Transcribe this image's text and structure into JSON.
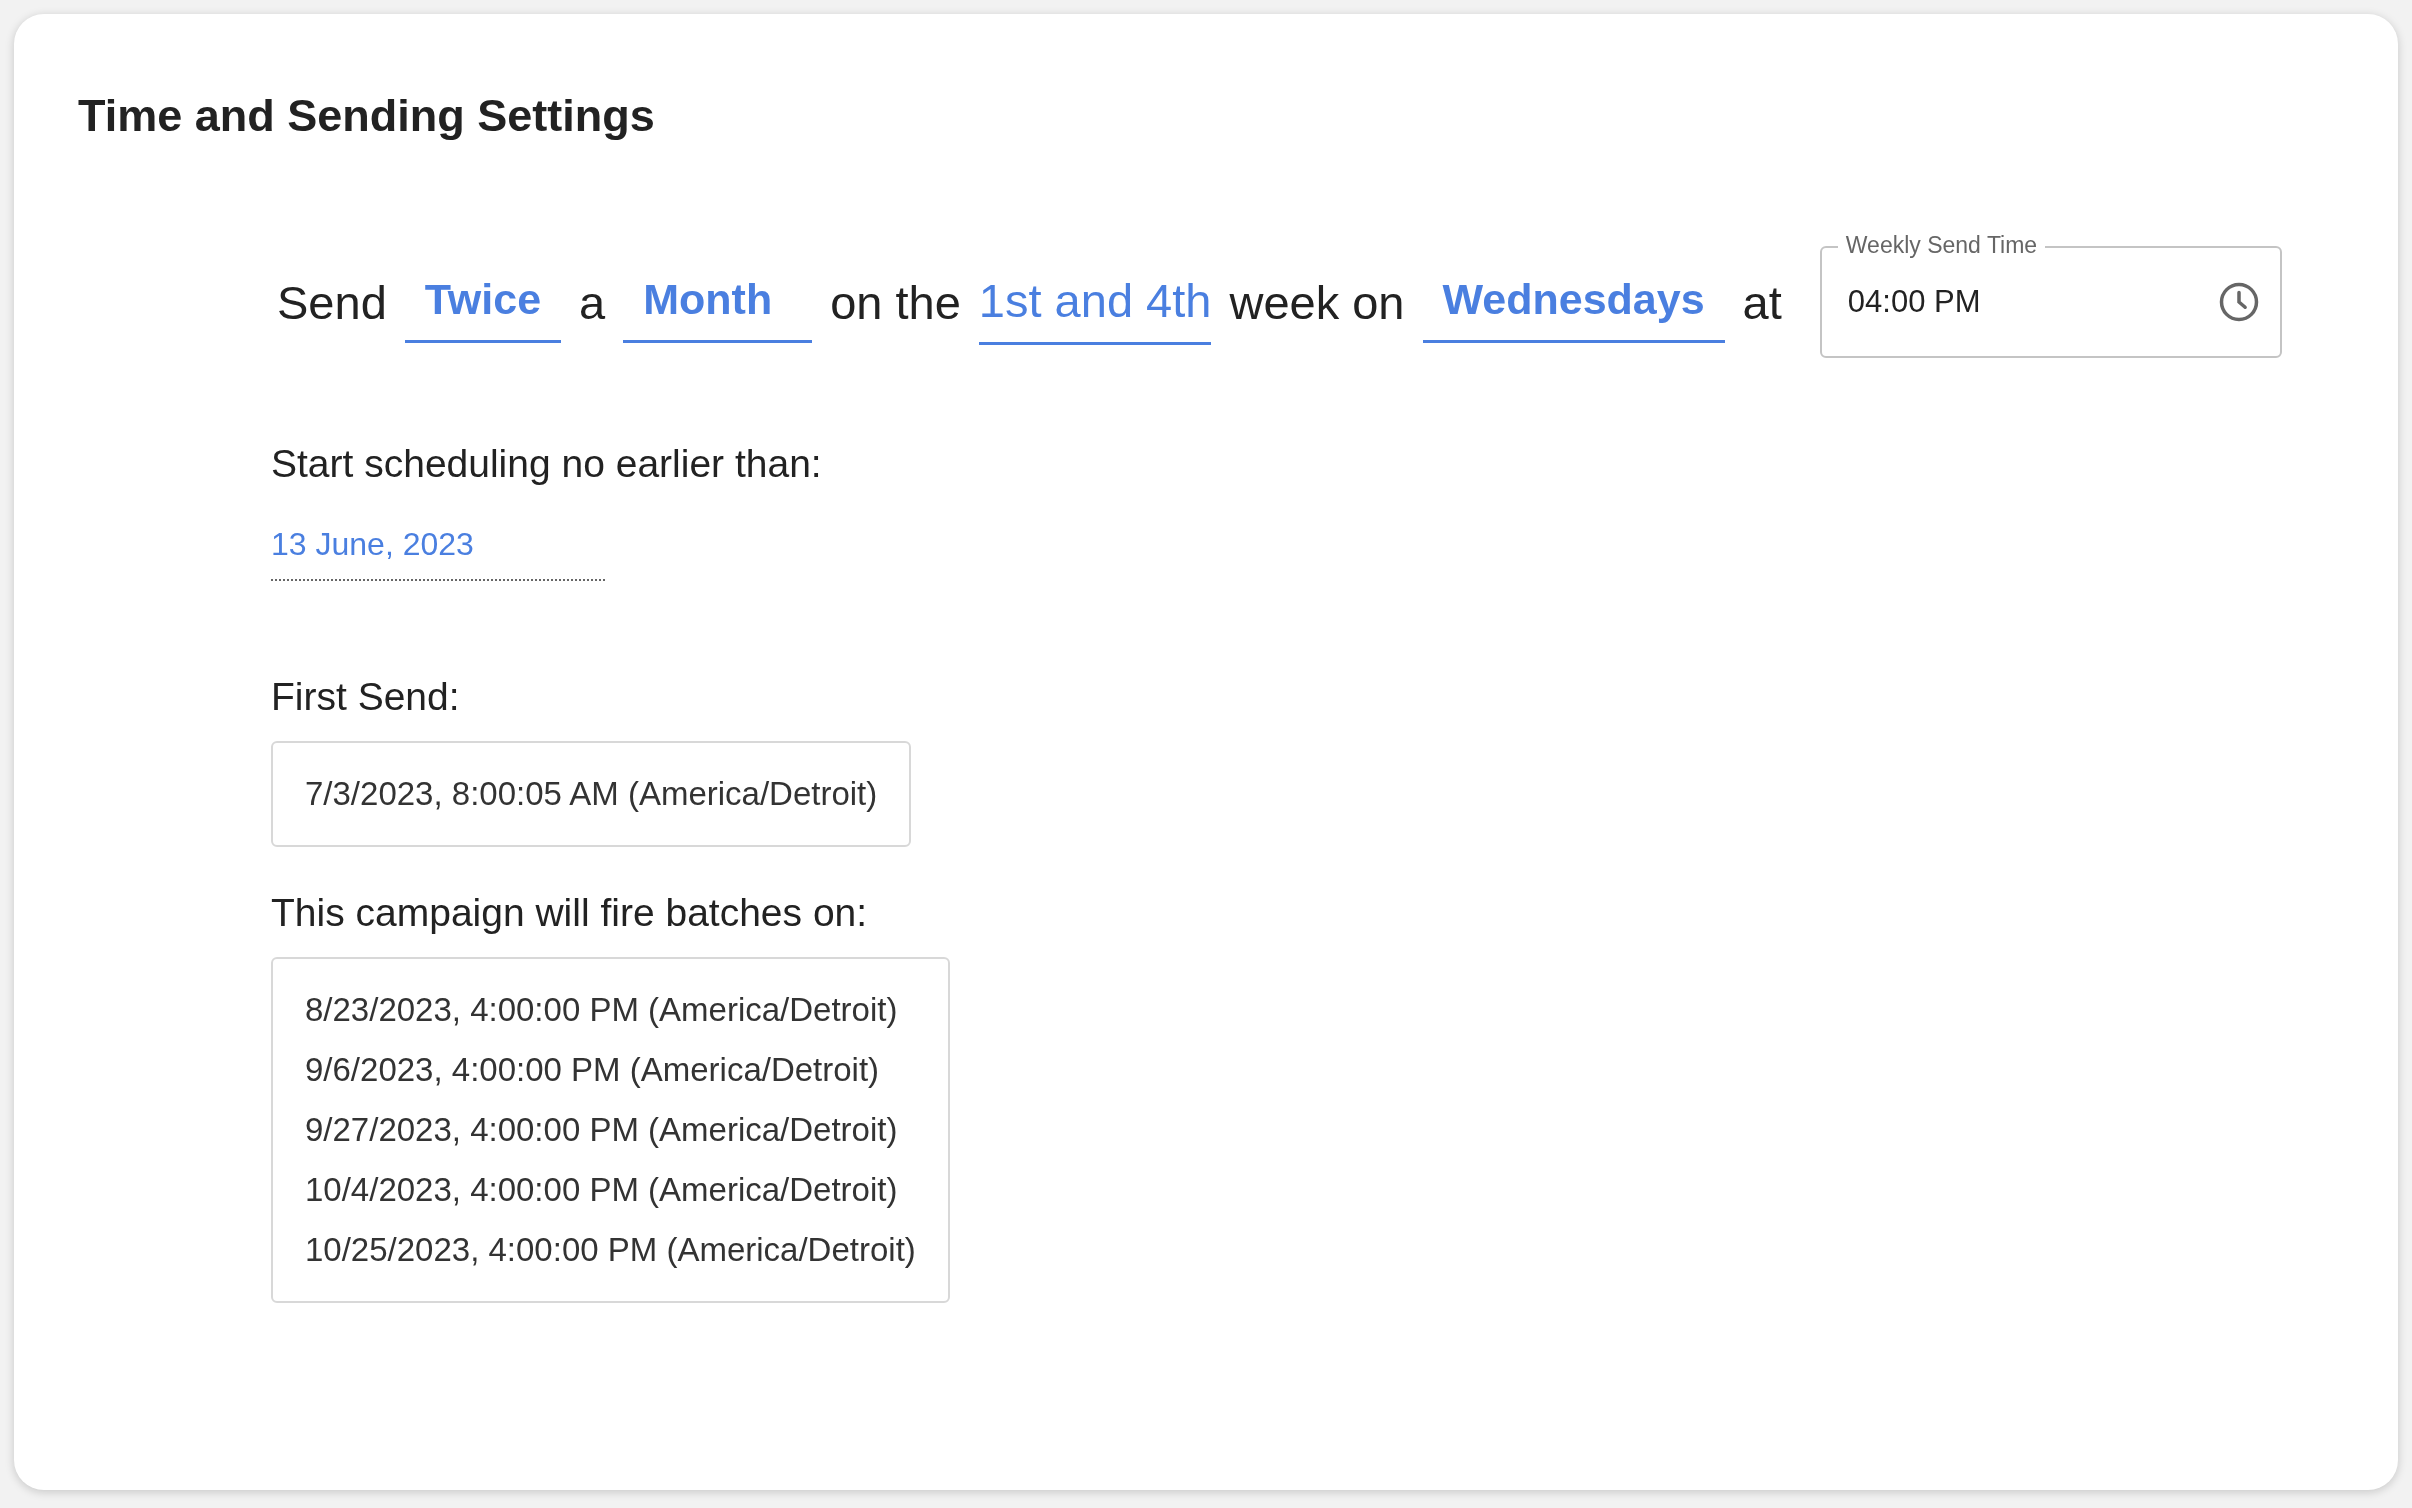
{
  "title": "Time and Sending Settings",
  "sentence": [
    {
      "kind": "text",
      "text": "Send"
    },
    {
      "kind": "select",
      "text": "Twice"
    },
    {
      "kind": "text",
      "text": "a"
    },
    {
      "kind": "select",
      "text": "Month"
    },
    {
      "kind": "text",
      "text": "on the"
    },
    {
      "kind": "link",
      "text": "1st and 4th"
    },
    {
      "kind": "text",
      "text": "week on"
    },
    {
      "kind": "select",
      "text": "Wednesdays"
    },
    {
      "kind": "text",
      "text": "at"
    }
  ],
  "send_time": {
    "label": "Weekly Send Time",
    "value": "04:00 PM"
  },
  "start": {
    "label": "Start scheduling no earlier than:",
    "value": "13 June, 2023"
  },
  "first_send": {
    "label": "First Send:",
    "value": "7/3/2023, 8:00:05 AM (America/Detroit)"
  },
  "batches": {
    "label": "This campaign will fire batches on:",
    "items": [
      "8/23/2023, 4:00:00 PM (America/Detroit)",
      "9/6/2023, 4:00:00 PM (America/Detroit)",
      "9/27/2023, 4:00:00 PM (America/Detroit)",
      "10/4/2023, 4:00:00 PM (America/Detroit)",
      "10/25/2023, 4:00:00 PM (America/Detroit)"
    ]
  }
}
